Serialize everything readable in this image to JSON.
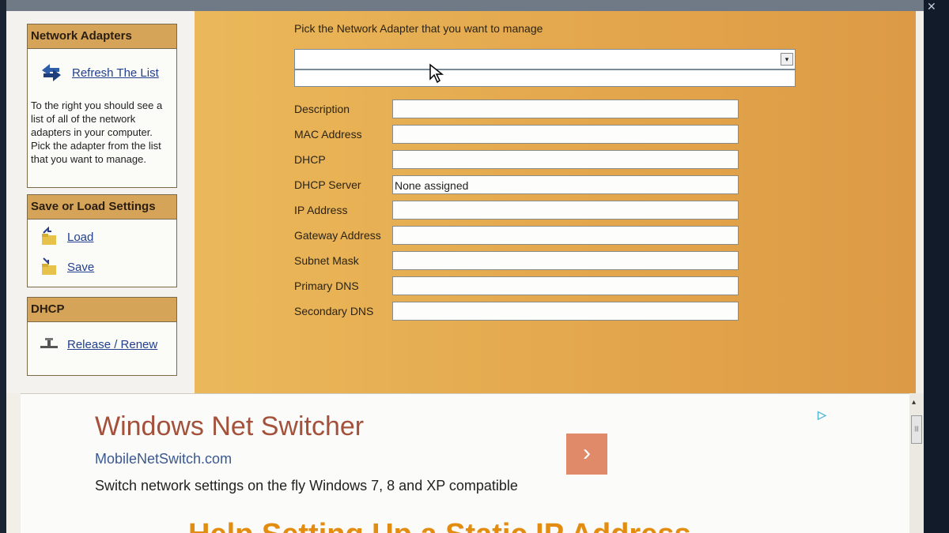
{
  "sidebar": {
    "network_adapters": {
      "header": "Network Adapters",
      "refresh_label": "Refresh The List",
      "help_text": "To the right you should see a list of all of the network adapters in your computer. Pick the adapter from the list that you want to manage."
    },
    "save_load": {
      "header": "Save or Load Settings",
      "load_label": "Load",
      "save_label": "Save"
    },
    "dhcp": {
      "header": "DHCP",
      "release_renew_label": "Release / Renew"
    }
  },
  "main": {
    "pick_label": "Pick the Network Adapter that you want to manage",
    "select_arrow_glyph": "▾",
    "fields": [
      {
        "label": "Description",
        "value": ""
      },
      {
        "label": "MAC Address",
        "value": ""
      },
      {
        "label": "DHCP",
        "value": ""
      },
      {
        "label": "DHCP Server",
        "value": "None assigned"
      },
      {
        "label": "IP Address",
        "value": ""
      },
      {
        "label": "Gateway Address",
        "value": ""
      },
      {
        "label": "Subnet Mask",
        "value": ""
      },
      {
        "label": "Primary DNS",
        "value": ""
      },
      {
        "label": "Secondary DNS",
        "value": ""
      }
    ]
  },
  "ad": {
    "title": "Windows Net Switcher",
    "url": "MobileNetSwitch.com",
    "description": "Switch network settings on the fly Windows 7, 8 and XP compatible",
    "button_glyph": "›",
    "adchoices_glyph": "▷"
  },
  "next_section": {
    "heading": "Help Setting Up a Static IP Address"
  },
  "scrollbar": {
    "up_arrow_glyph": "▴",
    "thumb_glyph": "|||"
  },
  "window": {
    "close_glyph": "✕"
  },
  "colors": {
    "panel_header": "#d6a458",
    "main_bg": "#e3a54b",
    "link": "#23408f",
    "ad_title": "#a4513b"
  }
}
